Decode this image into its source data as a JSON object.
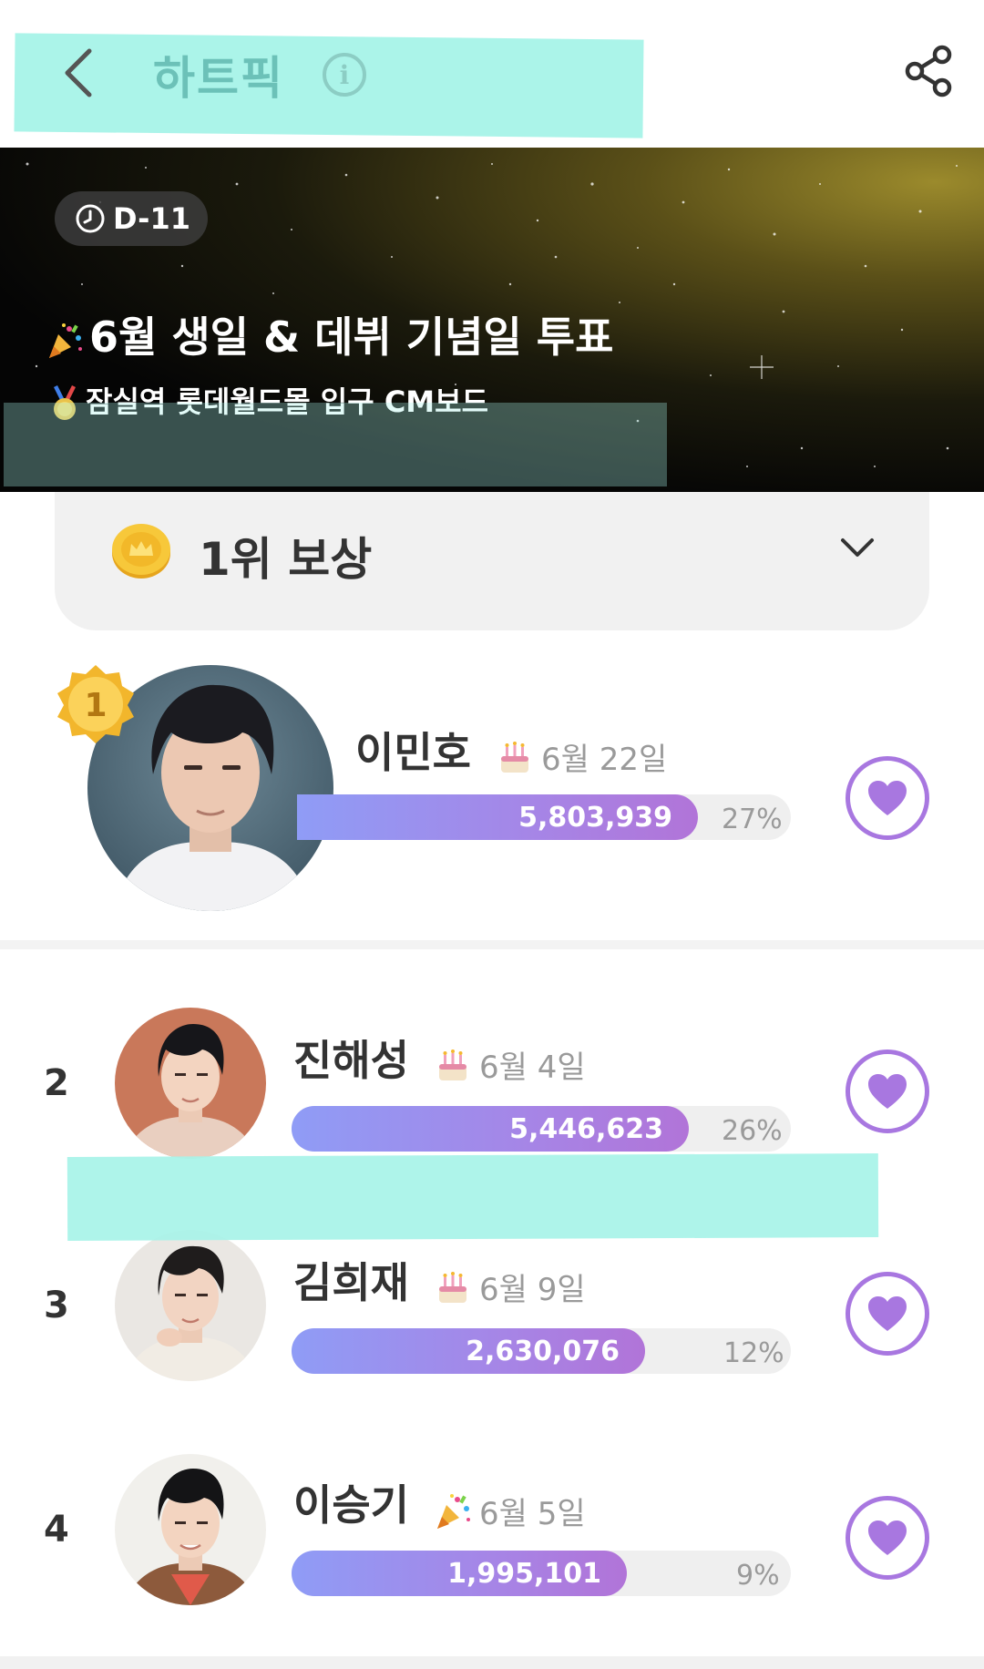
{
  "header": {
    "title": "하트픽"
  },
  "banner": {
    "dday": "D-11",
    "title": "6월 생일 & 데뷔 기념일 투표",
    "subtitle": "잠실역 롯데월드몰 입구 CM보드"
  },
  "reward": {
    "label": "1위 보상"
  },
  "ranking": [
    {
      "rank": "1",
      "name": "이민호",
      "date": "6월 22일",
      "event": "birthday",
      "votes": "5,803,939",
      "percent": "27%",
      "share": 0.27
    },
    {
      "rank": "2",
      "name": "진해성",
      "date": "6월 4일",
      "event": "birthday",
      "votes": "5,446,623",
      "percent": "26%",
      "share": 0.26
    },
    {
      "rank": "3",
      "name": "김희재",
      "date": "6월 9일",
      "event": "birthday",
      "votes": "2,630,076",
      "percent": "12%",
      "share": 0.12
    },
    {
      "rank": "4",
      "name": "이승기",
      "date": "6월 5일",
      "event": "debut",
      "votes": "1,995,101",
      "percent": "9%",
      "share": 0.09
    }
  ],
  "colors": {
    "accent": "#a877e0",
    "highlight": "#a7f3e8",
    "bar_start": "#8f9cf6",
    "bar_end": "#b174d8"
  }
}
